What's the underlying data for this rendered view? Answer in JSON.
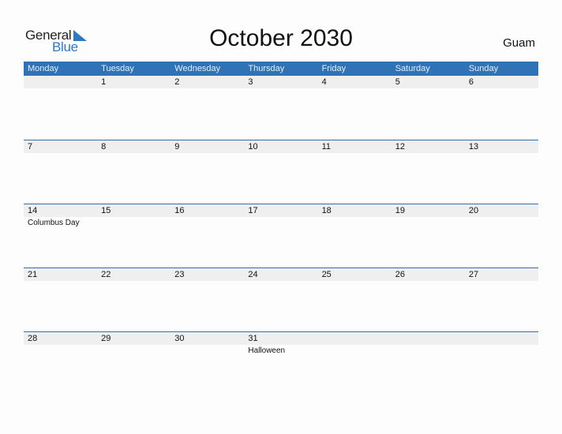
{
  "logo": {
    "text_general": "General",
    "text_blue": "Blue"
  },
  "title": "October 2030",
  "region": "Guam",
  "weekdays": [
    "Monday",
    "Tuesday",
    "Wednesday",
    "Thursday",
    "Friday",
    "Saturday",
    "Sunday"
  ],
  "weeks": [
    {
      "dates": [
        "",
        "1",
        "2",
        "3",
        "4",
        "5",
        "6"
      ],
      "events": [
        "",
        "",
        "",
        "",
        "",
        "",
        ""
      ]
    },
    {
      "dates": [
        "7",
        "8",
        "9",
        "10",
        "11",
        "12",
        "13"
      ],
      "events": [
        "",
        "",
        "",
        "",
        "",
        "",
        ""
      ]
    },
    {
      "dates": [
        "14",
        "15",
        "16",
        "17",
        "18",
        "19",
        "20"
      ],
      "events": [
        "Columbus Day",
        "",
        "",
        "",
        "",
        "",
        ""
      ]
    },
    {
      "dates": [
        "21",
        "22",
        "23",
        "24",
        "25",
        "26",
        "27"
      ],
      "events": [
        "",
        "",
        "",
        "",
        "",
        "",
        ""
      ]
    },
    {
      "dates": [
        "28",
        "29",
        "30",
        "31",
        "",
        "",
        ""
      ],
      "events": [
        "",
        "",
        "",
        "Halloween",
        "",
        "",
        ""
      ]
    }
  ]
}
